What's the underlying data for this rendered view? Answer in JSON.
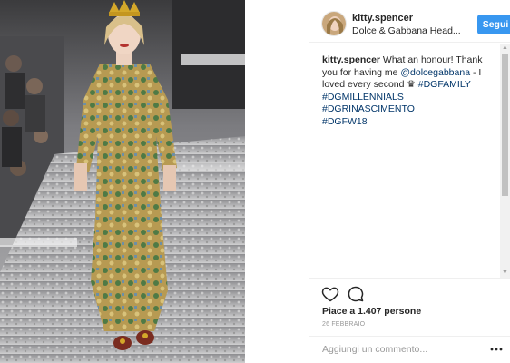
{
  "post": {
    "username": "kitty.spencer",
    "location": "Dolce & Gabbana Head...",
    "follow_label": "Segui",
    "caption": {
      "username": "kitty.spencer",
      "text_before_mention": " What an honour! Thank you for having me ",
      "mention": "@dolcegabbana",
      "text_after_mention": " - I loved every second ",
      "crown_emoji": "♛",
      "hashtags": [
        "#DGFAMILY",
        "#DGMILLENNIALS",
        "#DGRINASCIMENTO",
        "#DGFW18"
      ]
    },
    "likes_text": "Piace a 1.407 persone",
    "date": "26 FEBBRAIO",
    "comment_placeholder": "Aggiungi un commento...",
    "icons": {
      "like": "heart-icon",
      "comment": "comment-icon",
      "more": "more-options-icon"
    }
  },
  "colors": {
    "accent": "#3897f0",
    "link": "#003569",
    "text": "#262626",
    "muted": "#999999"
  }
}
